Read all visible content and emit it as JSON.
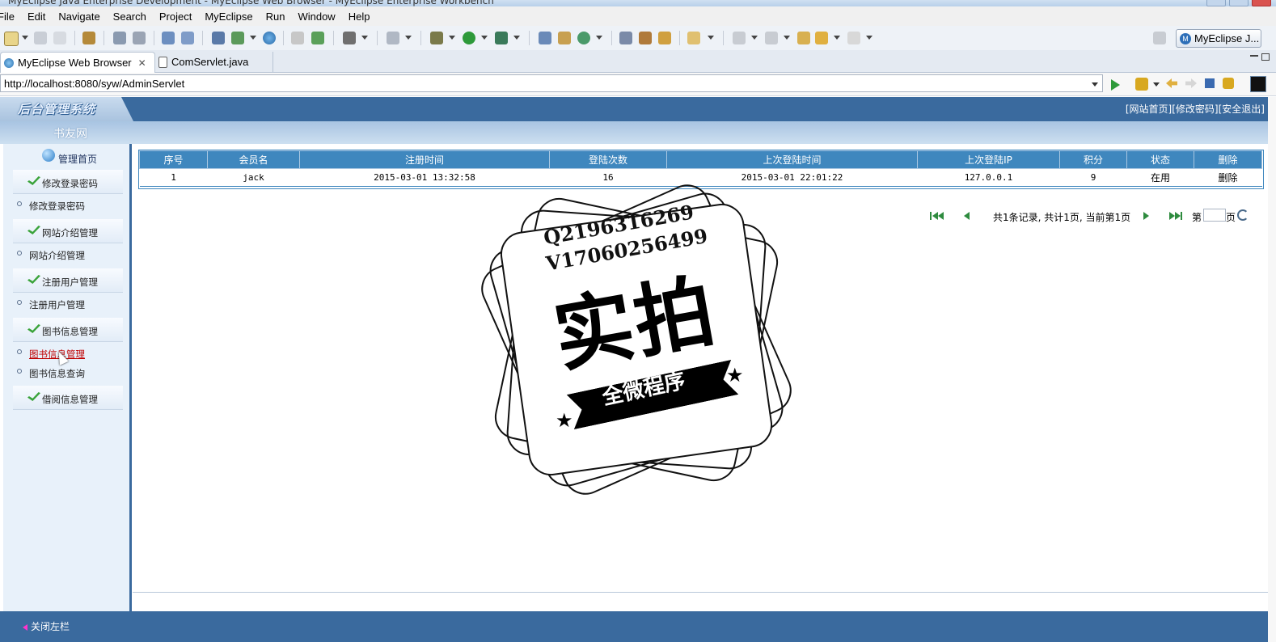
{
  "window": {
    "title": "MyEclipse Java Enterprise Development - MyEclipse Web Browser - MyEclipse Enterprise Workbench"
  },
  "menu": [
    "File",
    "Edit",
    "Navigate",
    "Search",
    "Project",
    "MyEclipse",
    "Run",
    "Window",
    "Help"
  ],
  "toolbar": {
    "perspective_label": "MyEclipse J..."
  },
  "tabs": [
    {
      "label": "MyEclipse Web Browser",
      "close": "✕"
    },
    {
      "label": "ComServlet.java"
    }
  ],
  "browser": {
    "url": "http://localhost:8080/syw/AdminServlet"
  },
  "app": {
    "system_title": "后台管理系统",
    "site_name": "书友网",
    "top_links": {
      "home": "[网站首页]",
      "change_pwd": "[修改密码]",
      "logout": "[安全退出]"
    },
    "nav": {
      "header": "管理首页",
      "groups": [
        {
          "label": "修改登录密码",
          "items": [
            "修改登录密码"
          ]
        },
        {
          "label": "网站介绍管理",
          "items": [
            "网站介绍管理"
          ]
        },
        {
          "label": "注册用户管理",
          "items": [
            "注册用户管理"
          ]
        },
        {
          "label": "图书信息管理",
          "items": [
            "图书信息管理",
            "图书信息查询"
          ]
        },
        {
          "label": "借阅信息管理",
          "items": []
        }
      ],
      "active_item": "图书信息管理"
    },
    "table": {
      "headers": [
        "序号",
        "会员名",
        "注册时间",
        "登陆次数",
        "上次登陆时间",
        "上次登陆IP",
        "积分",
        "状态",
        "删除"
      ],
      "rows": [
        [
          "1",
          "jack",
          "2015-03-01 13:32:58",
          "16",
          "2015-03-01 22:01:22",
          "127.0.0.1",
          "9",
          "在用",
          "删除"
        ]
      ]
    },
    "pager": {
      "summary": "共1条记录, 共计1页, 当前第1页",
      "page_prefix": "第",
      "page_suffix": "页",
      "page_value": ""
    },
    "footer": {
      "close_left": "关闭左栏"
    }
  },
  "watermark": {
    "qq": "Q2196316269",
    "wx": "V17060256499",
    "main": "实拍",
    "ribbon": "全微程序"
  }
}
